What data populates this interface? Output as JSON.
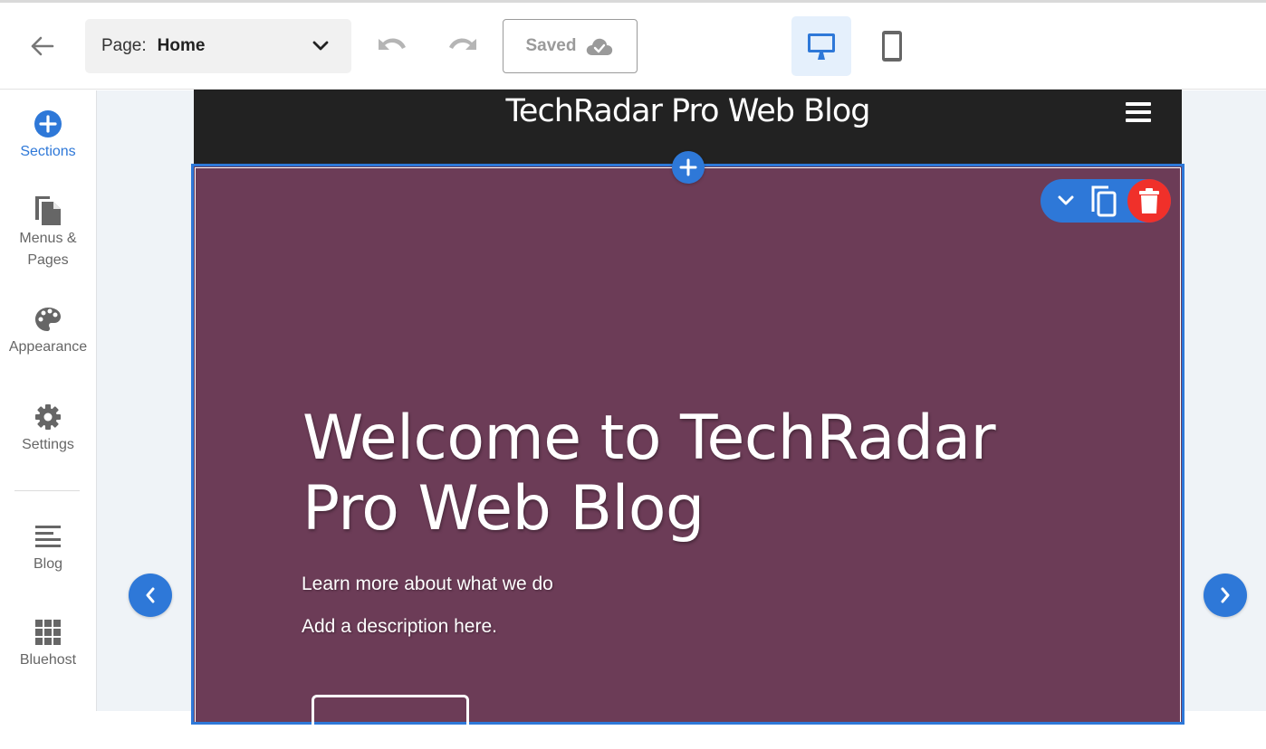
{
  "toolbar": {
    "back_icon": "arrow-left-icon",
    "page_select": {
      "label": "Page:",
      "value": "Home",
      "icon": "chevron-down-icon"
    },
    "undo_icon": "undo-icon",
    "redo_icon": "redo-icon",
    "saved": {
      "label": "Saved",
      "icon": "cloud-check-icon"
    },
    "devices": [
      {
        "name": "desktop",
        "icon": "desktop-icon",
        "active": true
      },
      {
        "name": "mobile",
        "icon": "mobile-icon",
        "active": false
      }
    ]
  },
  "sidebar": {
    "items": [
      {
        "label": "Sections",
        "icon": "plus-circle-icon",
        "active": true
      },
      {
        "label": "Menus & Pages",
        "label_line1": "Menus &",
        "label_line2": "Pages",
        "icon": "pages-icon"
      },
      {
        "label": "Appearance",
        "icon": "palette-icon"
      },
      {
        "label": "Settings",
        "icon": "gear-icon"
      },
      {
        "label": "Blog",
        "icon": "text-lines-icon"
      },
      {
        "label": "Bluehost",
        "icon": "grid-icon"
      }
    ]
  },
  "site": {
    "header_title": "TechRadar Pro Web Blog",
    "menu_icon": "hamburger-icon",
    "hero": {
      "title": "Welcome to TechRadar Pro Web Blog",
      "subtitle": "Learn more about what we do",
      "description": "Add a description here."
    }
  },
  "section_tools": {
    "collapse_icon": "chevron-down-icon",
    "copy_icon": "copy-icon",
    "delete_icon": "trash-icon"
  },
  "colors": {
    "accent": "#2e78d8",
    "hero_bg": "#6c3c57",
    "header_bg": "#222222",
    "delete": "#f0302a",
    "canvas_bg": "#eff3f7"
  }
}
